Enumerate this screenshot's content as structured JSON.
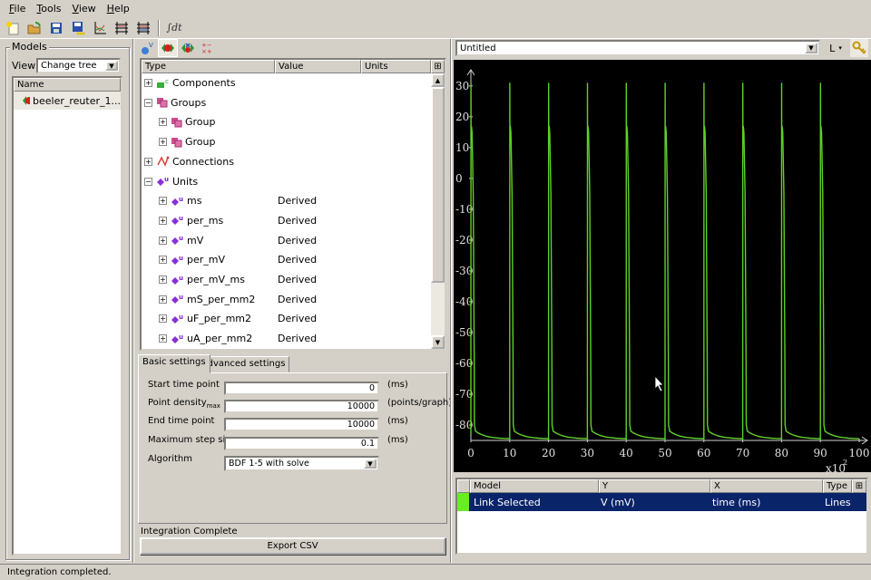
{
  "menubar": {
    "items": [
      "File",
      "Tools",
      "View",
      "Help"
    ]
  },
  "toolbar": {
    "buttons": [
      "new-icon",
      "open-icon",
      "save-icon",
      "save-all-icon",
      "add-graph-icon",
      "add-graph-row-icon",
      "add-graph-grid-icon"
    ],
    "integrate_label": "∫dt"
  },
  "models_panel": {
    "title": "Models",
    "view_label": "View",
    "view_selected": "Change tree",
    "list_header": "Name",
    "items": [
      "beeler_reuter_1..."
    ]
  },
  "tree": {
    "columns": [
      "Type",
      "Value",
      "Units"
    ],
    "rows": [
      {
        "label": "Components",
        "value": "",
        "expander": "+",
        "indent": 0,
        "icon": "component-icon"
      },
      {
        "label": "Groups",
        "value": "",
        "expander": "−",
        "indent": 0,
        "icon": "group-icon"
      },
      {
        "label": "Group",
        "value": "",
        "expander": "+",
        "indent": 1,
        "icon": "group-icon"
      },
      {
        "label": "Group",
        "value": "",
        "expander": "+",
        "indent": 1,
        "icon": "group-icon"
      },
      {
        "label": "Connections",
        "value": "",
        "expander": "+",
        "indent": 0,
        "icon": "connection-icon"
      },
      {
        "label": "Units",
        "value": "",
        "expander": "−",
        "indent": 0,
        "icon": "units-icon"
      },
      {
        "label": "ms",
        "value": "Derived",
        "expander": "+",
        "indent": 1,
        "icon": "units-icon"
      },
      {
        "label": "per_ms",
        "value": "Derived",
        "expander": "+",
        "indent": 1,
        "icon": "units-icon"
      },
      {
        "label": "mV",
        "value": "Derived",
        "expander": "+",
        "indent": 1,
        "icon": "units-icon"
      },
      {
        "label": "per_mV",
        "value": "Derived",
        "expander": "+",
        "indent": 1,
        "icon": "units-icon"
      },
      {
        "label": "per_mV_ms",
        "value": "Derived",
        "expander": "+",
        "indent": 1,
        "icon": "units-icon"
      },
      {
        "label": "mS_per_mm2",
        "value": "Derived",
        "expander": "+",
        "indent": 1,
        "icon": "units-icon"
      },
      {
        "label": "uF_per_mm2",
        "value": "Derived",
        "expander": "+",
        "indent": 1,
        "icon": "units-icon"
      },
      {
        "label": "uA_per_mm2",
        "value": "Derived",
        "expander": "+",
        "indent": 1,
        "icon": "units-icon"
      }
    ]
  },
  "settings": {
    "tabs": [
      "Basic settings",
      "Advanced settings"
    ],
    "active_tab": "Basic settings",
    "fields": [
      {
        "label": "Start time point",
        "sub": "",
        "value": "0",
        "unit": "(ms)"
      },
      {
        "label": "Point density",
        "sub": "max",
        "value": "10000",
        "unit": "(points/graph)"
      },
      {
        "label": "End time point",
        "sub": "",
        "value": "10000",
        "unit": "(ms)"
      },
      {
        "label": "Maximum step size",
        "sub": "",
        "value": "0.1",
        "unit": "(ms)"
      }
    ],
    "algorithm_label": "Algorithm",
    "algorithm_value": "BDF 1-5 with solve"
  },
  "integration_status": "Integration Complete",
  "export_label": "Export CSV",
  "graph": {
    "title_selected": "Untitled",
    "axis_button": "L",
    "background": "#000000",
    "trace_color": "#5fd02a"
  },
  "chart_data": {
    "type": "line",
    "title": "Untitled",
    "xlabel": "time (ms)",
    "ylabel": "V (mV)",
    "x_multiplier_label": "x10",
    "x_multiplier_exp": "2",
    "xlim": [
      0,
      100
    ],
    "ylim": [
      -85,
      32
    ],
    "xticks": [
      0,
      10,
      20,
      30,
      40,
      50,
      60,
      70,
      80,
      90,
      100
    ],
    "yticks": [
      30,
      20,
      10,
      0,
      -10,
      -20,
      -30,
      -40,
      -50,
      -60,
      -70,
      -80
    ],
    "grid": false,
    "series": [
      {
        "name": "Link Selected",
        "stimulus_times_x100ms": [
          0,
          10,
          20,
          30,
          40,
          50,
          60,
          70,
          80,
          90
        ],
        "peak_mV": 31,
        "plateau_mV": 17,
        "rest_mV": -84.5,
        "repolarization_end_x100ms": 0.9,
        "color": "#5fd02a"
      }
    ]
  },
  "legend_table": {
    "columns": [
      "",
      "Model",
      "Y",
      "X",
      "Type"
    ],
    "rows": [
      {
        "color": "#66ee22",
        "model": "Link Selected",
        "y": "V (mV)",
        "x": "time (ms)",
        "type": "Lines"
      }
    ]
  },
  "statusbar": "Integration completed."
}
